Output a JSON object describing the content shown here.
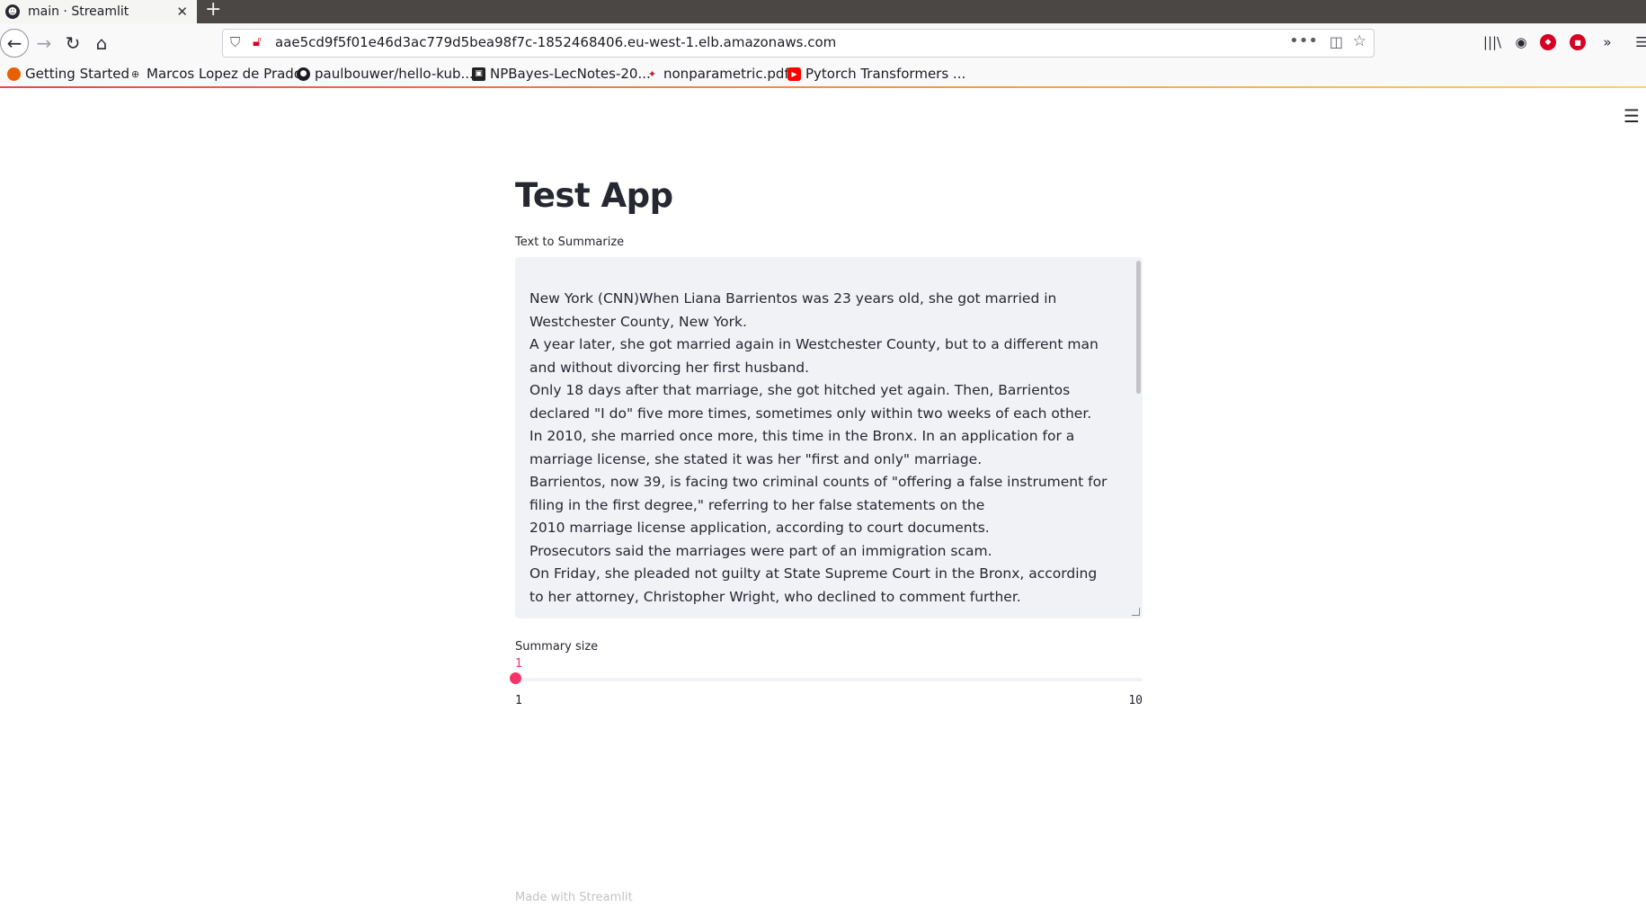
{
  "browser": {
    "tab": {
      "title": "main · Streamlit",
      "close": "✕"
    },
    "new_tab": "+",
    "url": "aae5cd9f5f01e46d3ac779d5bea98f7c-1852468406.eu-west-1.elb.amazonaws.com",
    "bookmarks": [
      {
        "label": "Getting Started",
        "icon": "firefox-icon"
      },
      {
        "label": "Marcos Lopez de Prado",
        "icon": "globe-icon"
      },
      {
        "label": "paulbouwer/hello-kub...",
        "icon": "github-icon"
      },
      {
        "label": "NPBayes-LecNotes-20...",
        "icon": "pdf-icon"
      },
      {
        "label": "nonparametric.pdf",
        "icon": "pdf-icon"
      },
      {
        "label": "Pytorch Transformers ...",
        "icon": "youtube-icon"
      }
    ]
  },
  "app": {
    "title": "Test App",
    "text_label": "Text to Summarize",
    "text_value": "New York (CNN)When Liana Barrientos was 23 years old, she got married in Westchester County, New York.\nA year later, she got married again in Westchester County, but to a different man and without divorcing her first husband.\nOnly 18 days after that marriage, she got hitched yet again. Then, Barrientos declared \"I do\" five more times, sometimes only within two weeks of each other.\nIn 2010, she married once more, this time in the Bronx. In an application for a marriage license, she stated it was her \"first and only\" marriage.\nBarrientos, now 39, is facing two criminal counts of \"offering a false instrument for filing in the first degree,\" referring to her false statements on the\n2010 marriage license application, according to court documents.\nProsecutors said the marriages were part of an immigration scam.\nOn Friday, she pleaded not guilty at State Supreme Court in the Bronx, according to her attorney, Christopher Wright, who declined to comment further.",
    "slider": {
      "label": "Summary size",
      "value": "1",
      "min": "1",
      "max": "10"
    },
    "footer": "Made with Streamlit"
  },
  "colors": {
    "accent": "#f63366",
    "text": "#262730",
    "input_bg": "#f0f2f6"
  }
}
